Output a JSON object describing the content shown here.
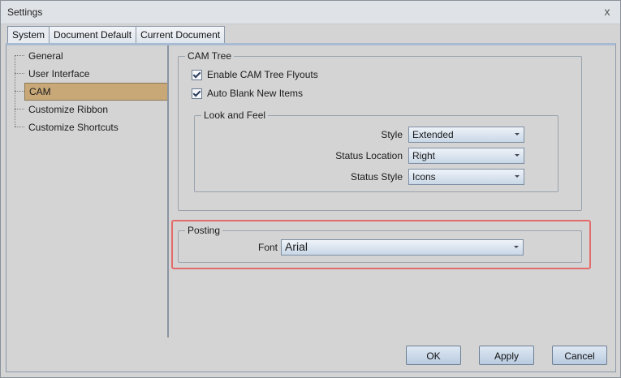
{
  "window": {
    "title": "Settings",
    "close_glyph": "x"
  },
  "tabs": [
    {
      "label": "System",
      "active": true
    },
    {
      "label": "Document Default",
      "active": false
    },
    {
      "label": "Current Document",
      "active": false
    }
  ],
  "tree": {
    "items": [
      {
        "label": "General"
      },
      {
        "label": "User Interface"
      },
      {
        "label": "CAM",
        "selected": true
      },
      {
        "label": "Customize Ribbon"
      },
      {
        "label": "Customize Shortcuts"
      }
    ]
  },
  "cam_tree": {
    "title": "CAM Tree",
    "enable_flyouts_label": "Enable CAM Tree Flyouts",
    "auto_blank_label": "Auto Blank New Items",
    "look_and_feel": {
      "title": "Look and Feel",
      "style_label": "Style",
      "style_value": "Extended",
      "status_location_label": "Status Location",
      "status_location_value": "Right",
      "status_style_label": "Status Style",
      "status_style_value": "Icons"
    }
  },
  "posting": {
    "title": "Posting",
    "font_label": "Font",
    "font_value": "Arial"
  },
  "buttons": {
    "ok": "OK",
    "apply": "Apply",
    "cancel": "Cancel"
  },
  "colors": {
    "selected_item": "#c9a878",
    "highlight": "#e46b6b"
  }
}
